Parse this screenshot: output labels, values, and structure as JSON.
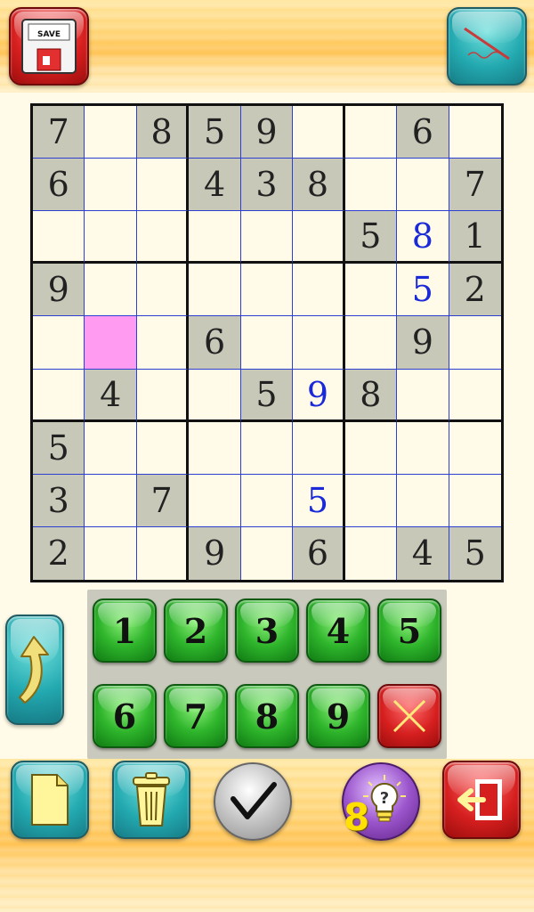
{
  "toolbar": {
    "save_label": "SAVE",
    "save_icon": "floppy-disk-icon",
    "pencil_icon": "pencil-icon"
  },
  "board": {
    "selected": [
      4,
      1
    ],
    "rows": [
      [
        {
          "v": "7",
          "t": "given"
        },
        {
          "v": "",
          "t": "empty"
        },
        {
          "v": "8",
          "t": "given"
        },
        {
          "v": "5",
          "t": "given"
        },
        {
          "v": "9",
          "t": "given"
        },
        {
          "v": "",
          "t": "empty"
        },
        {
          "v": "",
          "t": "empty"
        },
        {
          "v": "6",
          "t": "given"
        },
        {
          "v": "",
          "t": "empty"
        }
      ],
      [
        {
          "v": "6",
          "t": "given"
        },
        {
          "v": "",
          "t": "empty"
        },
        {
          "v": "",
          "t": "empty"
        },
        {
          "v": "4",
          "t": "given"
        },
        {
          "v": "3",
          "t": "given"
        },
        {
          "v": "8",
          "t": "given"
        },
        {
          "v": "",
          "t": "empty"
        },
        {
          "v": "",
          "t": "empty"
        },
        {
          "v": "7",
          "t": "given"
        }
      ],
      [
        {
          "v": "",
          "t": "empty"
        },
        {
          "v": "",
          "t": "empty"
        },
        {
          "v": "",
          "t": "empty"
        },
        {
          "v": "",
          "t": "empty"
        },
        {
          "v": "",
          "t": "empty"
        },
        {
          "v": "",
          "t": "empty"
        },
        {
          "v": "5",
          "t": "given"
        },
        {
          "v": "8",
          "t": "user"
        },
        {
          "v": "1",
          "t": "given"
        }
      ],
      [
        {
          "v": "9",
          "t": "given"
        },
        {
          "v": "",
          "t": "empty"
        },
        {
          "v": "",
          "t": "empty"
        },
        {
          "v": "",
          "t": "empty"
        },
        {
          "v": "",
          "t": "empty"
        },
        {
          "v": "",
          "t": "empty"
        },
        {
          "v": "",
          "t": "empty"
        },
        {
          "v": "5",
          "t": "user"
        },
        {
          "v": "2",
          "t": "given"
        }
      ],
      [
        {
          "v": "",
          "t": "empty"
        },
        {
          "v": "",
          "t": "empty"
        },
        {
          "v": "",
          "t": "empty"
        },
        {
          "v": "6",
          "t": "given"
        },
        {
          "v": "",
          "t": "empty"
        },
        {
          "v": "",
          "t": "empty"
        },
        {
          "v": "",
          "t": "empty"
        },
        {
          "v": "9",
          "t": "given"
        },
        {
          "v": "",
          "t": "empty"
        }
      ],
      [
        {
          "v": "",
          "t": "empty"
        },
        {
          "v": "4",
          "t": "given"
        },
        {
          "v": "",
          "t": "empty"
        },
        {
          "v": "",
          "t": "empty"
        },
        {
          "v": "5",
          "t": "given"
        },
        {
          "v": "9",
          "t": "user"
        },
        {
          "v": "8",
          "t": "given"
        },
        {
          "v": "",
          "t": "empty"
        },
        {
          "v": "",
          "t": "empty"
        }
      ],
      [
        {
          "v": "5",
          "t": "given"
        },
        {
          "v": "",
          "t": "empty"
        },
        {
          "v": "",
          "t": "empty"
        },
        {
          "v": "",
          "t": "empty"
        },
        {
          "v": "",
          "t": "empty"
        },
        {
          "v": "",
          "t": "empty"
        },
        {
          "v": "",
          "t": "empty"
        },
        {
          "v": "",
          "t": "empty"
        },
        {
          "v": "",
          "t": "empty"
        }
      ],
      [
        {
          "v": "3",
          "t": "given"
        },
        {
          "v": "",
          "t": "empty"
        },
        {
          "v": "7",
          "t": "given"
        },
        {
          "v": "",
          "t": "empty"
        },
        {
          "v": "",
          "t": "empty"
        },
        {
          "v": "5",
          "t": "user"
        },
        {
          "v": "",
          "t": "empty"
        },
        {
          "v": "",
          "t": "empty"
        },
        {
          "v": "",
          "t": "empty"
        }
      ],
      [
        {
          "v": "2",
          "t": "given"
        },
        {
          "v": "",
          "t": "empty"
        },
        {
          "v": "",
          "t": "empty"
        },
        {
          "v": "9",
          "t": "given"
        },
        {
          "v": "",
          "t": "empty"
        },
        {
          "v": "6",
          "t": "given"
        },
        {
          "v": "",
          "t": "empty"
        },
        {
          "v": "4",
          "t": "given"
        },
        {
          "v": "5",
          "t": "given"
        }
      ]
    ]
  },
  "keypad": {
    "keys": [
      "1",
      "2",
      "3",
      "4",
      "5",
      "6",
      "7",
      "8",
      "9"
    ],
    "clear_icon": "x-icon"
  },
  "controls": {
    "undo_icon": "undo-arrow-icon",
    "new_icon": "new-document-icon",
    "trash_icon": "trash-can-icon",
    "check_icon": "checkmark-icon",
    "hint_icon": "lightbulb-question-icon",
    "hint_count": "8",
    "exit_icon": "exit-door-icon"
  },
  "colors": {
    "given_cell": "#c8c8b8",
    "user_digit": "#1a2ad8",
    "selected_cell": "#ff9cf2",
    "grid_line": "#2c3fd1",
    "key_green": "#2fb52c",
    "key_red": "#d61f1f",
    "tile_teal": "#23a9b0"
  }
}
